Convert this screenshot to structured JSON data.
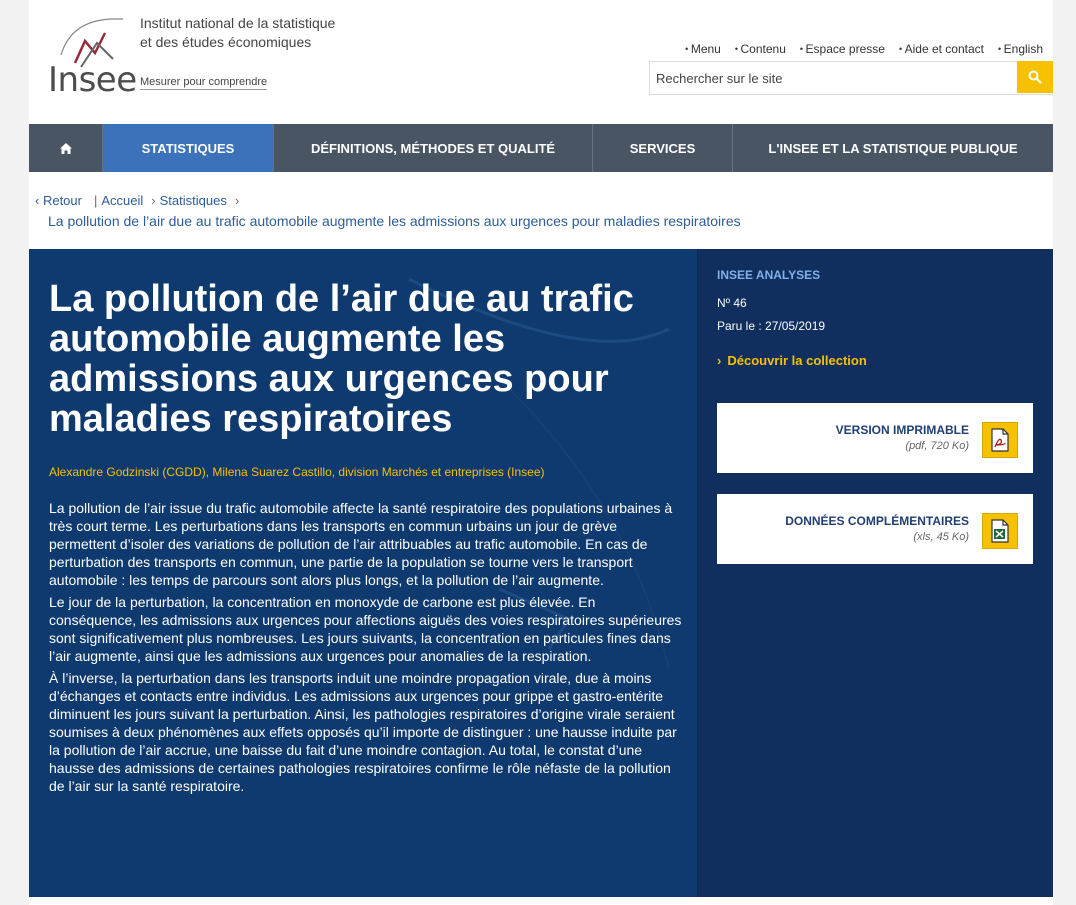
{
  "header": {
    "org_line1": "Institut national de la statistique",
    "org_line2": "et des études économiques",
    "logo_text": "Insee",
    "tagline": "Mesurer pour comprendre",
    "top_links": [
      "Menu",
      "Contenu",
      "Espace presse",
      "Aide et contact",
      "English"
    ],
    "search_placeholder": "Rechercher sur le site"
  },
  "nav": {
    "items": [
      "STATISTIQUES",
      "DÉFINITIONS, MÉTHODES ET QUALITÉ",
      "SERVICES",
      "L'INSEE ET LA STATISTIQUE PUBLIQUE"
    ]
  },
  "breadcrumb": {
    "back": "Retour",
    "home": "Accueil",
    "section": "Statistiques",
    "current": "La pollution de l’air due au trafic automobile augmente les admissions aux urgences pour maladies respiratoires"
  },
  "article": {
    "title": "La pollution de l’air due au trafic automobile augmente les admissions aux urgences pour maladies respiratoires",
    "authors": "Alexandre Godzinski (CGDD), Milena Suarez Castillo, division Marchés et entreprises (Insee)",
    "paragraphs": [
      "La pollution de l’air issue du trafic automobile affecte la santé respiratoire des populations urbaines à très court terme. Les perturbations dans les transports en commun urbains un jour de grève permettent d’isoler des variations de pollution de l’air attribuables au trafic automobile. En cas de perturbation des transports en commun, une partie de la population se tourne vers le transport automobile : les temps de parcours sont alors plus longs, et la pollution de l’air augmente.",
      "Le jour de la perturbation, la concentration en monoxyde de carbone est plus élevée. En conséquence, les admissions aux urgences pour affections aiguës des voies respiratoires supérieures sont significativement plus nombreuses. Les jours suivants, la concentration en particules fines dans l’air augmente, ainsi que les admissions aux urgences pour anomalies de la respiration.",
      "À l’inverse, la perturbation dans les transports induit une moindre propagation virale, due à moins d’échanges et contacts entre individus. Les admissions aux urgences pour grippe et gastro-entérite diminuent les jours suivant la perturbation. Ainsi, les pathologies respiratoires d’origine virale seraient soumises à deux phénomènes aux effets opposés qu’il importe de distinguer : une hausse induite par la pollution de l’air accrue, une baisse du fait d’une moindre contagion. Au total, le constat d’une hausse des admissions de certaines pathologies respiratoires confirme le rôle néfaste de la pollution de l’air sur la santé respiratoire."
    ]
  },
  "sidebar": {
    "series": "INSEE ANALYSES",
    "number": "Nº 46",
    "date": "Paru le : 27/05/2019",
    "collection_link": "Découvrir la collection",
    "downloads": [
      {
        "label": "VERSION IMPRIMABLE",
        "sub": "(pdf, 720 Ko)",
        "icon": "pdf-icon"
      },
      {
        "label": "DONNÉES COMPLÉMENTAIRES",
        "sub": "(xls, 45 Ko)",
        "icon": "xls-icon"
      }
    ]
  },
  "colors": {
    "hero_bg": "#0f3a6f",
    "sidebar_bg": "#102f5f",
    "accent_yellow": "#f6c100",
    "nav_bg": "#4a5564",
    "nav_active": "#3b72b9"
  }
}
